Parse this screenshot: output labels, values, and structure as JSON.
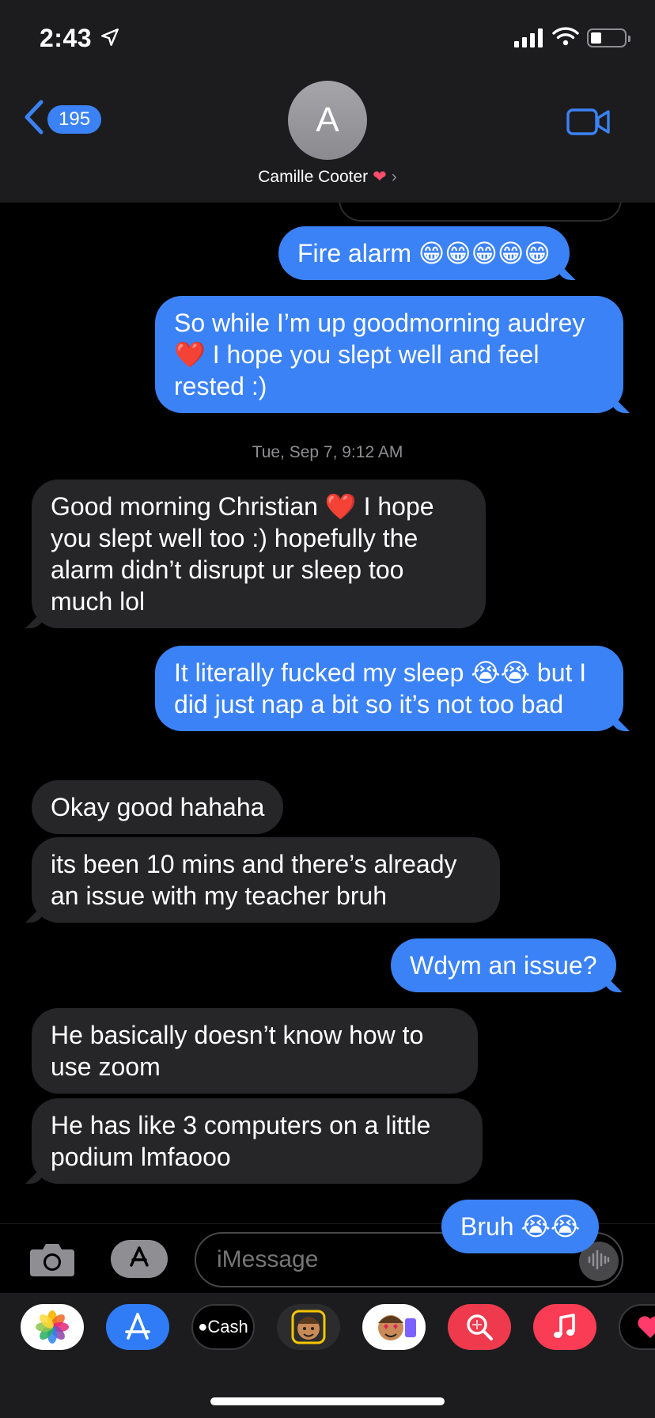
{
  "status_bar": {
    "time": "2:43"
  },
  "header": {
    "back_count": "195",
    "avatar_initial": "A",
    "contact_name": "Camille Cooter"
  },
  "messages": [
    {
      "from": "me",
      "text": "Fire alarm 😁😁😁😁😁"
    },
    {
      "from": "me",
      "text": "So while I’m up goodmorning audrey ❤️ I hope you slept well and feel rested :)"
    },
    {
      "from": "them",
      "text": "Good morning Christian ❤️ I hope you slept well too :) hopefully the alarm didn’t disrupt ur sleep too much lol"
    },
    {
      "from": "me",
      "text": "It literally fucked my sleep 😭😭 but I did just nap a bit so it’s not too bad"
    },
    {
      "from": "them",
      "text": "Okay good hahaha"
    },
    {
      "from": "them",
      "text": "its been 10 mins and there’s already an issue with my teacher bruh"
    },
    {
      "from": "me",
      "text": "Wdym an issue?"
    },
    {
      "from": "them",
      "text": "He basically doesn’t know how to use zoom"
    },
    {
      "from": "them",
      "text": "He has like 3 computers on a little podium lmfaooo"
    },
    {
      "from": "me",
      "text": "Bruh 😭😭"
    }
  ],
  "timestamp": "Tue, Sep 7, 9:12 AM",
  "input": {
    "placeholder": "iMessage"
  },
  "app_drawer": [
    {
      "name": "photos-app-icon"
    },
    {
      "name": "app-store-icon"
    },
    {
      "label": "Cash"
    },
    {
      "name": "memoji-icon"
    },
    {
      "name": "memoji-stickers-icon"
    },
    {
      "name": "images-search-icon"
    },
    {
      "name": "music-icon"
    },
    {
      "name": "digital-touch-icon"
    }
  ],
  "colors": {
    "sent": "#3b82f6",
    "received": "#262628",
    "header": "#1c1c1e"
  }
}
